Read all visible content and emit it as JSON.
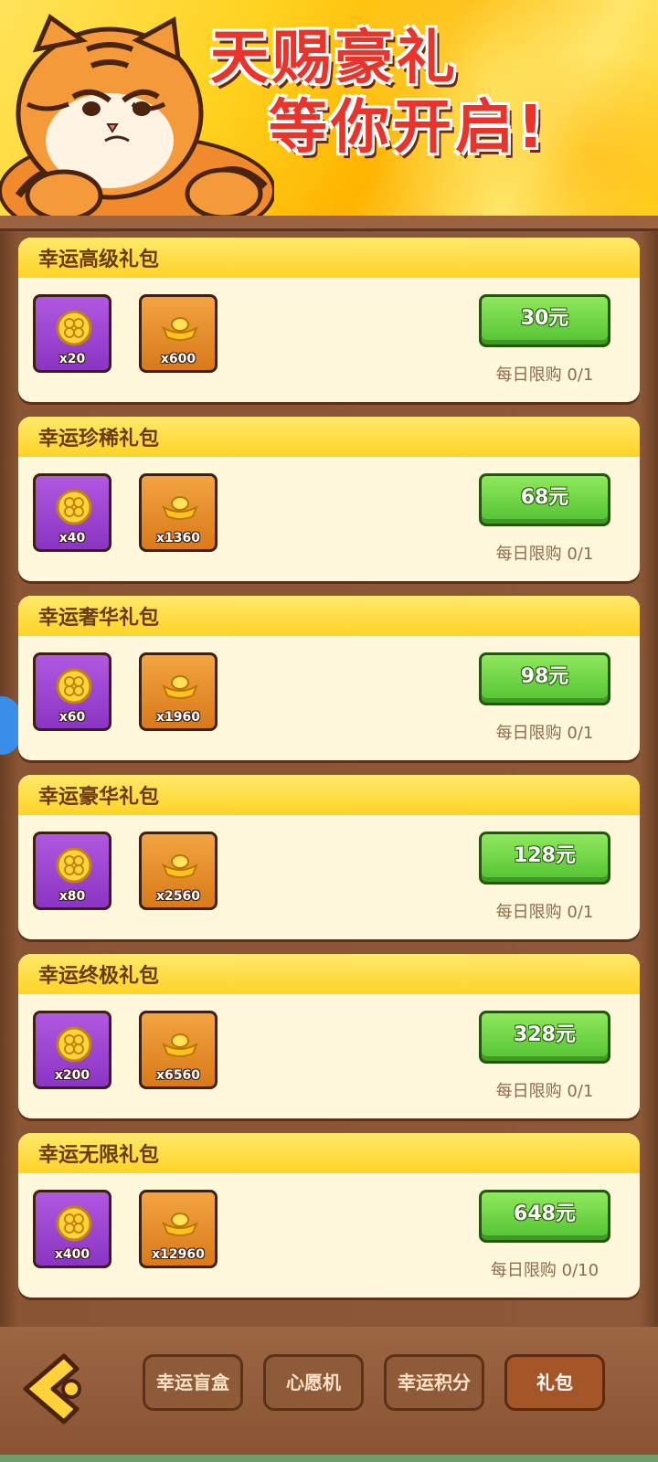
{
  "banner": {
    "line1": "天赐豪礼",
    "line2": "等你开启!"
  },
  "packs": [
    {
      "title": "幸运高级礼包",
      "clover_qty": "x20",
      "ingot_qty": "x600",
      "price": "30元",
      "limit": "每日限购 0/1"
    },
    {
      "title": "幸运珍稀礼包",
      "clover_qty": "x40",
      "ingot_qty": "x1360",
      "price": "68元",
      "limit": "每日限购 0/1"
    },
    {
      "title": "幸运奢华礼包",
      "clover_qty": "x60",
      "ingot_qty": "x1960",
      "price": "98元",
      "limit": "每日限购 0/1"
    },
    {
      "title": "幸运豪华礼包",
      "clover_qty": "x80",
      "ingot_qty": "x2560",
      "price": "128元",
      "limit": "每日限购 0/1"
    },
    {
      "title": "幸运终极礼包",
      "clover_qty": "x200",
      "ingot_qty": "x6560",
      "price": "328元",
      "limit": "每日限购 0/1"
    },
    {
      "title": "幸运无限礼包",
      "clover_qty": "x400",
      "ingot_qty": "x12960",
      "price": "648元",
      "limit": "每日限购 0/10"
    }
  ],
  "tabs": [
    "幸运盲盒",
    "心愿机",
    "幸运积分",
    "礼包"
  ],
  "active_tab": "礼包",
  "icons": {
    "clover": "clover-coin-icon",
    "ingot": "gold-ingot-icon",
    "back": "back-arrow-icon"
  },
  "colors": {
    "price_button": "#52c232",
    "title_text": "#e8342a"
  }
}
